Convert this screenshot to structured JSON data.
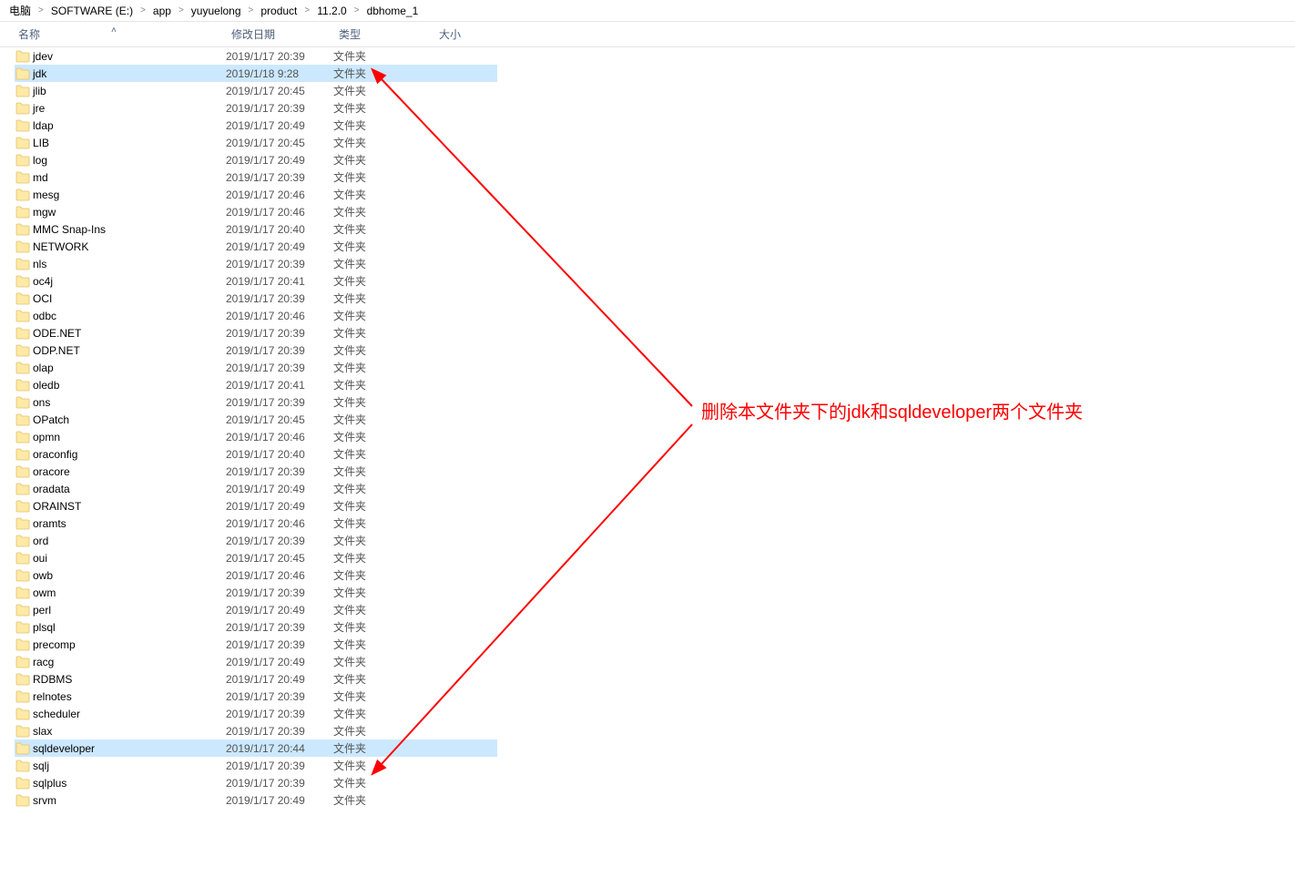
{
  "breadcrumb": [
    "电脑",
    "SOFTWARE (E:)",
    "app",
    "yuyuelong",
    "product",
    "11.2.0",
    "dbhome_1"
  ],
  "columns": {
    "name": "名称",
    "date": "修改日期",
    "type": "类型",
    "size": "大小"
  },
  "type_label": "文件夹",
  "annotation": "删除本文件夹下的jdk和sqldeveloper两个文件夹",
  "rows": [
    {
      "name": "jdev",
      "date": "2019/1/17 20:39",
      "sel": false
    },
    {
      "name": "jdk",
      "date": "2019/1/18 9:28",
      "sel": true
    },
    {
      "name": "jlib",
      "date": "2019/1/17 20:45",
      "sel": false
    },
    {
      "name": "jre",
      "date": "2019/1/17 20:39",
      "sel": false
    },
    {
      "name": "ldap",
      "date": "2019/1/17 20:49",
      "sel": false
    },
    {
      "name": "LIB",
      "date": "2019/1/17 20:45",
      "sel": false
    },
    {
      "name": "log",
      "date": "2019/1/17 20:49",
      "sel": false
    },
    {
      "name": "md",
      "date": "2019/1/17 20:39",
      "sel": false
    },
    {
      "name": "mesg",
      "date": "2019/1/17 20:46",
      "sel": false
    },
    {
      "name": "mgw",
      "date": "2019/1/17 20:46",
      "sel": false
    },
    {
      "name": "MMC Snap-Ins",
      "date": "2019/1/17 20:40",
      "sel": false
    },
    {
      "name": "NETWORK",
      "date": "2019/1/17 20:49",
      "sel": false
    },
    {
      "name": "nls",
      "date": "2019/1/17 20:39",
      "sel": false
    },
    {
      "name": "oc4j",
      "date": "2019/1/17 20:41",
      "sel": false
    },
    {
      "name": "OCI",
      "date": "2019/1/17 20:39",
      "sel": false
    },
    {
      "name": "odbc",
      "date": "2019/1/17 20:46",
      "sel": false
    },
    {
      "name": "ODE.NET",
      "date": "2019/1/17 20:39",
      "sel": false
    },
    {
      "name": "ODP.NET",
      "date": "2019/1/17 20:39",
      "sel": false
    },
    {
      "name": "olap",
      "date": "2019/1/17 20:39",
      "sel": false
    },
    {
      "name": "oledb",
      "date": "2019/1/17 20:41",
      "sel": false
    },
    {
      "name": "ons",
      "date": "2019/1/17 20:39",
      "sel": false
    },
    {
      "name": "OPatch",
      "date": "2019/1/17 20:45",
      "sel": false
    },
    {
      "name": "opmn",
      "date": "2019/1/17 20:46",
      "sel": false
    },
    {
      "name": "oraconfig",
      "date": "2019/1/17 20:40",
      "sel": false
    },
    {
      "name": "oracore",
      "date": "2019/1/17 20:39",
      "sel": false
    },
    {
      "name": "oradata",
      "date": "2019/1/17 20:49",
      "sel": false
    },
    {
      "name": "ORAINST",
      "date": "2019/1/17 20:49",
      "sel": false
    },
    {
      "name": "oramts",
      "date": "2019/1/17 20:46",
      "sel": false
    },
    {
      "name": "ord",
      "date": "2019/1/17 20:39",
      "sel": false
    },
    {
      "name": "oui",
      "date": "2019/1/17 20:45",
      "sel": false
    },
    {
      "name": "owb",
      "date": "2019/1/17 20:46",
      "sel": false
    },
    {
      "name": "owm",
      "date": "2019/1/17 20:39",
      "sel": false
    },
    {
      "name": "perl",
      "date": "2019/1/17 20:49",
      "sel": false
    },
    {
      "name": "plsql",
      "date": "2019/1/17 20:39",
      "sel": false
    },
    {
      "name": "precomp",
      "date": "2019/1/17 20:39",
      "sel": false
    },
    {
      "name": "racg",
      "date": "2019/1/17 20:49",
      "sel": false
    },
    {
      "name": "RDBMS",
      "date": "2019/1/17 20:49",
      "sel": false
    },
    {
      "name": "relnotes",
      "date": "2019/1/17 20:39",
      "sel": false
    },
    {
      "name": "scheduler",
      "date": "2019/1/17 20:39",
      "sel": false
    },
    {
      "name": "slax",
      "date": "2019/1/17 20:39",
      "sel": false
    },
    {
      "name": "sqldeveloper",
      "date": "2019/1/17 20:44",
      "sel": true
    },
    {
      "name": "sqlj",
      "date": "2019/1/17 20:39",
      "sel": false
    },
    {
      "name": "sqlplus",
      "date": "2019/1/17 20:39",
      "sel": false
    },
    {
      "name": "srvm",
      "date": "2019/1/17 20:49",
      "sel": false
    }
  ]
}
